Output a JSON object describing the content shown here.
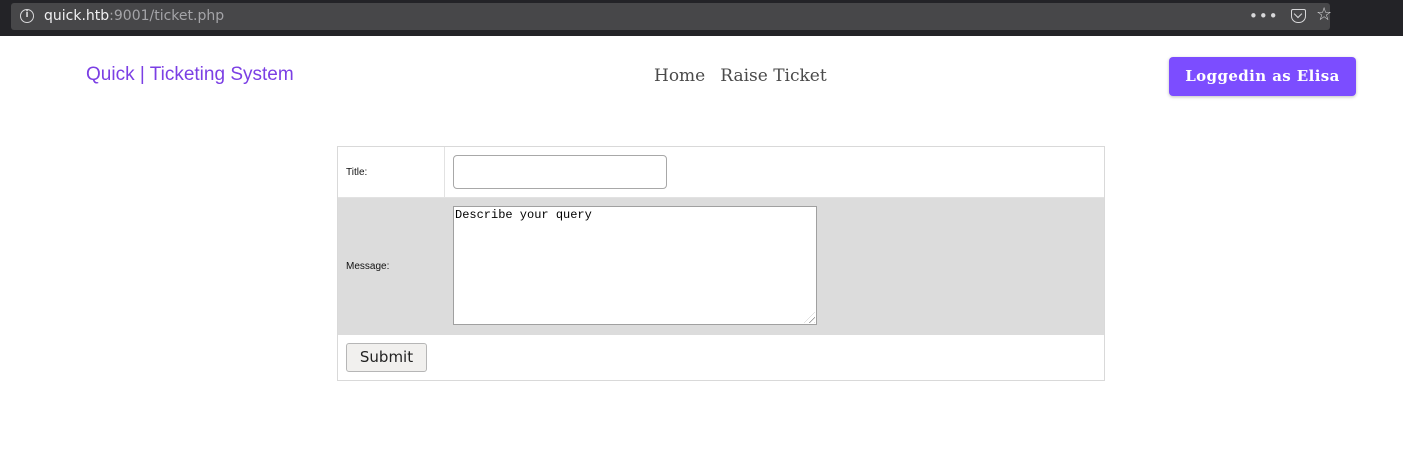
{
  "browser": {
    "url_host": "quick.htb",
    "url_rest": ":9001/ticket.php",
    "info_icon": "info-icon",
    "more_icon": "more-icon",
    "pocket_icon": "pocket-icon",
    "bookmark_icon": "star-icon"
  },
  "header": {
    "brand": "Quick | Ticketing System",
    "nav": [
      "Home",
      "Raise Ticket"
    ],
    "login_label": "Loggedin as Elisa",
    "accent_color": "#7c4dff",
    "brand_color": "#7b3fe4"
  },
  "form": {
    "title_label": "Title:",
    "title_value": "",
    "message_label": "Message:",
    "message_value": "Describe your query",
    "submit_label": "Submit"
  }
}
